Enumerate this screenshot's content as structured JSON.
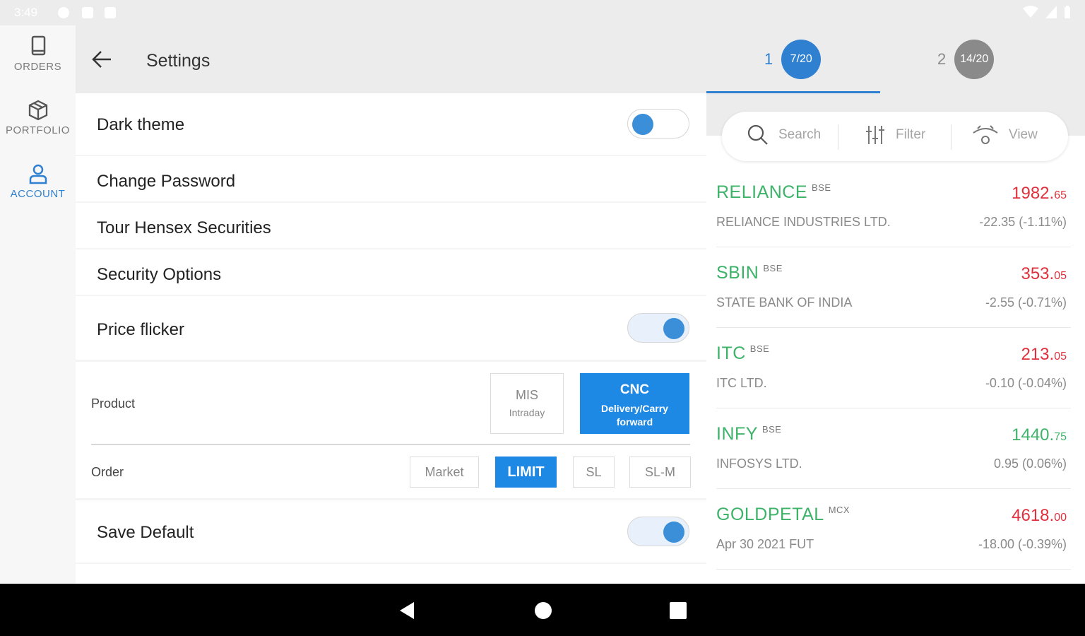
{
  "status_bar": {
    "time": "3:49"
  },
  "left_nav": {
    "items": [
      {
        "label": "ORDERS",
        "icon": "book-icon",
        "active": false
      },
      {
        "label": "PORTFOLIO",
        "icon": "box-icon",
        "active": false
      },
      {
        "label": "ACCOUNT",
        "icon": "user-icon",
        "active": true
      }
    ]
  },
  "settings": {
    "title": "Settings",
    "dark_theme": {
      "label": "Dark theme",
      "on": false
    },
    "change_password": "Change Password",
    "tour": "Tour Hensex Securities",
    "security_options": "Security Options",
    "price_flicker": {
      "label": "Price flicker",
      "on": true
    },
    "product": {
      "label": "Product",
      "options": [
        {
          "title": "MIS",
          "sub": "Intraday",
          "selected": false
        },
        {
          "title": "CNC",
          "sub": "Delivery/Carry forward",
          "selected": true
        }
      ]
    },
    "order": {
      "label": "Order",
      "options": [
        {
          "title": "Market",
          "selected": false
        },
        {
          "title": "LIMIT",
          "selected": true
        },
        {
          "title": "SL",
          "selected": false
        },
        {
          "title": "SL-M",
          "selected": false
        }
      ]
    },
    "save_default": {
      "label": "Save Default",
      "on": true
    }
  },
  "watchlist_tabs": [
    {
      "number": "1",
      "count": "7/20",
      "active": true,
      "color": "#2f80d1"
    },
    {
      "number": "2",
      "count": "14/20",
      "active": false,
      "color": "#8a8a8a"
    }
  ],
  "toolbar": {
    "search": "Search",
    "filter": "Filter",
    "view": "View"
  },
  "colors": {
    "accent": "#2f80d1",
    "up": "#3db36a",
    "down": "#e0303c"
  },
  "stocks": [
    {
      "symbol": "RELIANCE",
      "exchange": "BSE",
      "name": "RELIANCE INDUSTRIES LTD.",
      "price_int": "1982.",
      "price_dec": "65",
      "change": "-22.35 (-1.11%)",
      "direction": "down"
    },
    {
      "symbol": "SBIN",
      "exchange": "BSE",
      "name": "STATE BANK OF INDIA",
      "price_int": "353.",
      "price_dec": "05",
      "change": "-2.55 (-0.71%)",
      "direction": "down"
    },
    {
      "symbol": "ITC",
      "exchange": "BSE",
      "name": "ITC LTD.",
      "price_int": "213.",
      "price_dec": "05",
      "change": "-0.10 (-0.04%)",
      "direction": "down"
    },
    {
      "symbol": "INFY",
      "exchange": "BSE",
      "name": "INFOSYS LTD.",
      "price_int": "1440.",
      "price_dec": "75",
      "change": "0.95 (0.06%)",
      "direction": "up"
    },
    {
      "symbol": "GOLDPETAL",
      "exchange": "MCX",
      "name": "Apr 30 2021 FUT",
      "price_int": "4618.",
      "price_dec": "00",
      "change": "-18.00 (-0.39%)",
      "direction": "down"
    }
  ]
}
